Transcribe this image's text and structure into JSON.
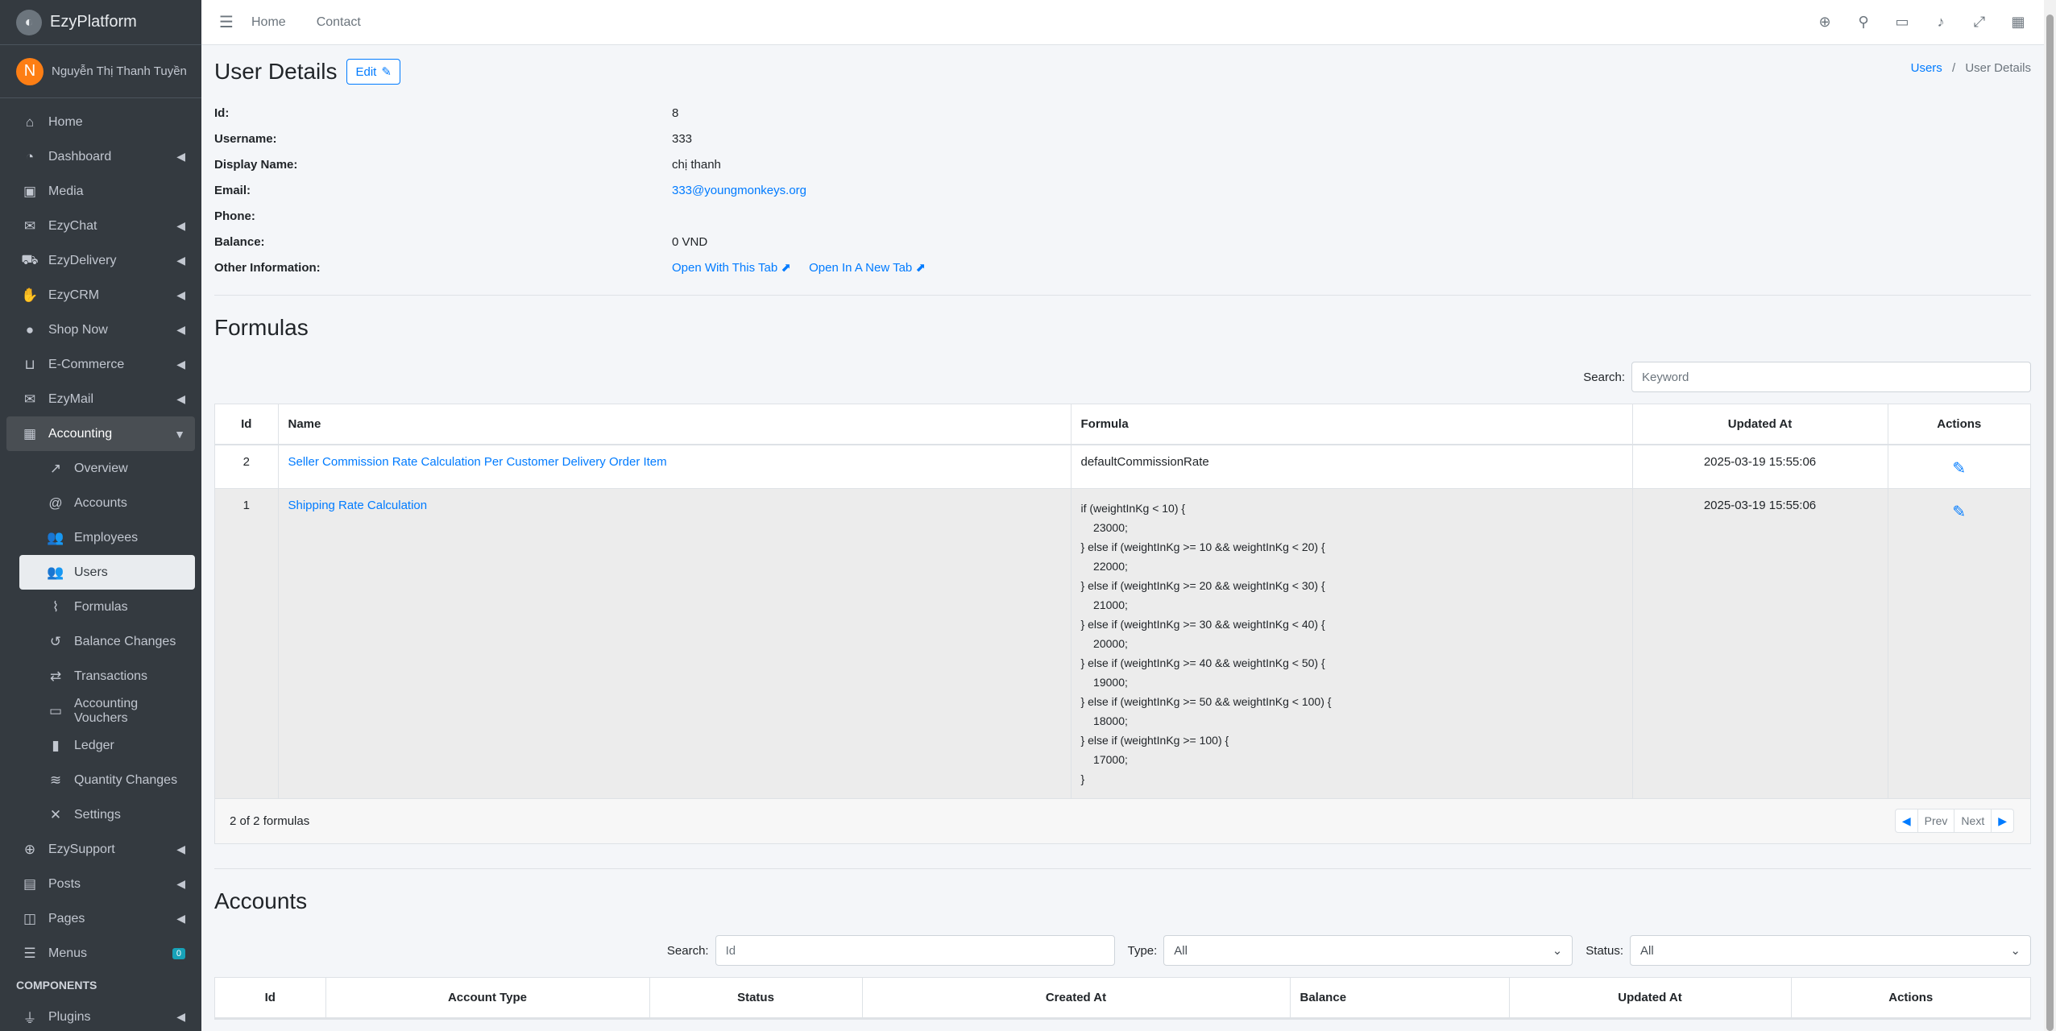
{
  "brand": {
    "name": "EzyPlatform",
    "logo_icon": "ezy-logo-icon"
  },
  "user": {
    "initial": "N",
    "name": "Nguyễn Thị Thanh Tuyền"
  },
  "nav": [
    {
      "label": "Home",
      "icon": "home-icon",
      "arrow": false
    },
    {
      "label": "Dashboard",
      "icon": "dashboard-icon",
      "arrow": true
    },
    {
      "label": "Media",
      "icon": "image-icon",
      "arrow": false
    },
    {
      "label": "EzyChat",
      "icon": "chat-icon",
      "arrow": true
    },
    {
      "label": "EzyDelivery",
      "icon": "truck-icon",
      "arrow": true
    },
    {
      "label": "EzyCRM",
      "icon": "handshake-icon",
      "arrow": true
    },
    {
      "label": "Shop Now",
      "icon": "circle-icon",
      "arrow": true
    },
    {
      "label": "E-Commerce",
      "icon": "basket-icon",
      "arrow": true
    },
    {
      "label": "EzyMail",
      "icon": "mail-icon",
      "arrow": true
    },
    {
      "label": "Accounting",
      "icon": "calculator-icon",
      "arrow": true
    }
  ],
  "accounting_sub": [
    {
      "label": "Overview",
      "icon": "chart-line-icon"
    },
    {
      "label": "Accounts",
      "icon": "at-icon"
    },
    {
      "label": "Employees",
      "icon": "users-icon"
    },
    {
      "label": "Users",
      "icon": "users-group-icon"
    },
    {
      "label": "Formulas",
      "icon": "wave-icon"
    },
    {
      "label": "Balance Changes",
      "icon": "history-icon"
    },
    {
      "label": "Transactions",
      "icon": "exchange-icon"
    },
    {
      "label": "Accounting Vouchers",
      "icon": "voucher-icon"
    },
    {
      "label": "Ledger",
      "icon": "book-icon"
    },
    {
      "label": "Quantity Changes",
      "icon": "stack-icon"
    },
    {
      "label": "Settings",
      "icon": "tools-icon"
    }
  ],
  "nav_after": [
    {
      "label": "EzySupport",
      "icon": "lifebuoy-icon",
      "arrow": true
    },
    {
      "label": "Posts",
      "icon": "posts-icon",
      "arrow": true
    },
    {
      "label": "Pages",
      "icon": "pages-icon",
      "arrow": true
    },
    {
      "label": "Menus",
      "icon": "menu-icon",
      "badge": "0"
    }
  ],
  "nav_header": "COMPONENTS",
  "nav_last": {
    "label": "Plugins",
    "icon": "plug-icon"
  },
  "topbar": {
    "links": [
      "Home",
      "Contact"
    ]
  },
  "header": {
    "title": "User Details",
    "edit_label": "Edit"
  },
  "breadcrumb": {
    "parent": "Users",
    "current": "User Details"
  },
  "details": [
    {
      "label": "Id:",
      "value": "8"
    },
    {
      "label": "Username:",
      "value": "333"
    },
    {
      "label": "Display Name:",
      "value": "chị thanh"
    },
    {
      "label": "Email:",
      "value": "333@youngmonkeys.org",
      "link": true
    },
    {
      "label": "Phone:",
      "value": ""
    },
    {
      "label": "Balance:",
      "value": "0 VND"
    }
  ],
  "other_info": {
    "label": "Other Information:",
    "open_this_tab": "Open With This Tab",
    "open_new_tab": "Open In A New Tab"
  },
  "formulas": {
    "title": "Formulas",
    "search_label": "Search:",
    "search_placeholder": "Keyword",
    "columns": [
      "Id",
      "Name",
      "Formula",
      "Updated At",
      "Actions"
    ],
    "rows": [
      {
        "id": "2",
        "name": "Seller Commission Rate Calculation Per Customer Delivery Order Item",
        "formula": "defaultCommissionRate",
        "updated_at": "2025-03-19 15:55:06"
      },
      {
        "id": "1",
        "name": "Shipping Rate Calculation",
        "formula": "if (weightInKg < 10) {\n    23000;\n} else if (weightInKg >= 10 && weightInKg < 20) {\n    22000;\n} else if (weightInKg >= 20 && weightInKg < 30) {\n    21000;\n} else if (weightInKg >= 30 && weightInKg < 40) {\n    20000;\n} else if (weightInKg >= 40 && weightInKg < 50) {\n    19000;\n} else if (weightInKg >= 50 && weightInKg < 100) {\n    18000;\n} else if (weightInKg >= 100) {\n    17000;\n}",
        "updated_at": "2025-03-19 15:55:06"
      }
    ],
    "summary": "2 of 2 formulas",
    "prev": "Prev",
    "next": "Next"
  },
  "accounts": {
    "title": "Accounts",
    "search_label": "Search:",
    "search_placeholder": "Id",
    "type_label": "Type:",
    "type_value": "All",
    "status_label": "Status:",
    "status_value": "All",
    "columns": [
      "Id",
      "Account Type",
      "Status",
      "Created At",
      "Balance",
      "Updated At",
      "Actions"
    ]
  }
}
